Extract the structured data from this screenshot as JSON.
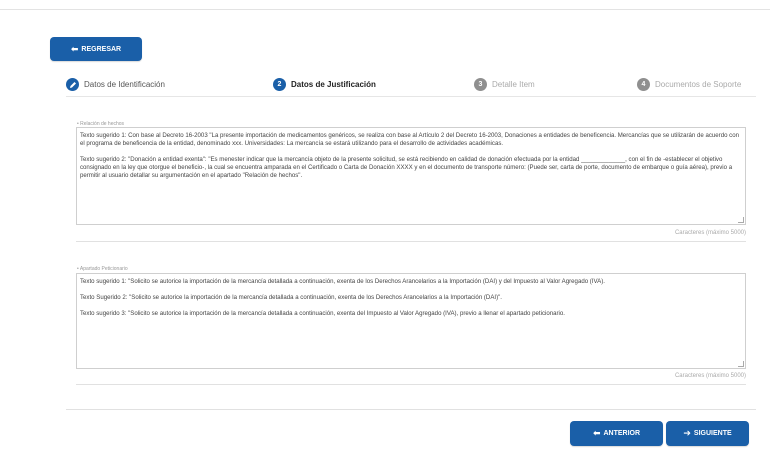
{
  "nav": {
    "back_label": "REGRESAR"
  },
  "steps": [
    {
      "number": "",
      "label": "Datos de Identificación",
      "state": "done"
    },
    {
      "number": "2",
      "label": "Datos de Justificación",
      "state": "active"
    },
    {
      "number": "3",
      "label": "Detalle Item",
      "state": "pending"
    },
    {
      "number": "4",
      "label": "Documentos de Soporte",
      "state": "pending"
    }
  ],
  "form": {
    "relacion": {
      "label": "• Relación de hechos",
      "paragraph_1": "Texto sugerido 1: Con base al Decreto 16-2003 \"La presente importación de medicamentos genéricos, se realiza con base al Artículo 2 del Decreto 16-2003, Donaciones a entidades de beneficencia. Mercancías que se utilizarán de acuerdo con el programa de beneficencia de la entidad, denominado xxx. Universidades: La mercancía se estará utilizando para el desarrollo de actividades académicas.",
      "paragraph_2": "Texto sugerido 2: \"Donación a entidad exenta\": \"Es menester indicar que la mercancía objeto de la presente solicitud, se está recibiendo en calidad de donación efectuada por la entidad _____________, con el fin de -establecer el objetivo consignado en la ley que otorgue el beneficio-, la cual se encuentra amparada en el Certificado o Carta de Donación XXXX y en el documento de transporte número: (Puede ser, carta de porte, documento de embarque o guía aérea), previo a permitir al usuario detallar su argumentación en el apartado \"Relación de hechos\".",
      "counter": "Caracteres (máximo 5000)"
    },
    "apartado": {
      "label": "• Apartado Peticionario",
      "paragraph_1": "Texto sugerido 1: \"Solicito se autorice la importación de la mercancía detallada a continuación, exenta de los Derechos Arancelarios a la Importación (DAI) y del Impuesto al Valor Agregado (IVA).",
      "paragraph_2": "Texto Sugerido 2: \"Solicito se autorice la importación de la mercancía detallada a continuación, exenta de los Derechos Arancelarios a la Importación (DAI)\".",
      "paragraph_3": "Texto sugerido 3: \"Solicito se autorice la importación de la mercancía detallada a continuación, exenta del Impuesto al Valor Agregado (IVA), previo a llenar el apartado peticionario.",
      "counter": "Caracteres (máximo 5000)"
    }
  },
  "footer": {
    "prev_label": "ANTERIOR",
    "next_label": "SIGUIENTE"
  },
  "colors": {
    "primary": "#1a5fa8",
    "pending": "#8f8f8f"
  }
}
